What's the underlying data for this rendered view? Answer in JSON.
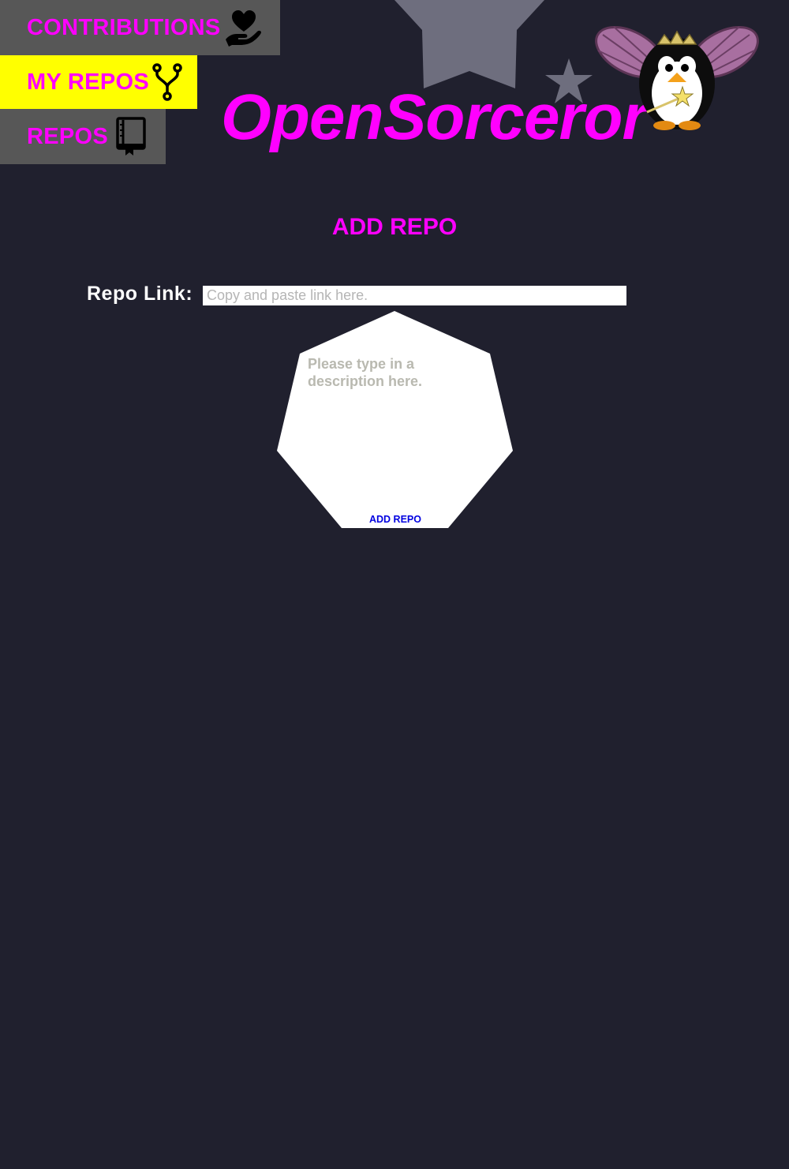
{
  "nav": {
    "contributions_label": "CONTRIBUTIONS",
    "my_repos_label": "MY REPOS",
    "repos_label": "REPOS",
    "contributions_icon": "heart-hand-icon",
    "my_repos_icon": "fork-icon",
    "repos_icon": "repo-book-icon",
    "active_item": "MY REPOS"
  },
  "header": {
    "logo_text": "OpenSorceror",
    "mascot": "fairy-penguin-mascot"
  },
  "main": {
    "heading": "ADD REPO",
    "repo_link_label": "Repo Link:",
    "repo_link_placeholder": "Copy and paste link here.",
    "description_placeholder": "Please type in a description here.",
    "submit_label": "ADD REPO"
  },
  "colors": {
    "background": "#20202e",
    "accent": "#ff00ff",
    "nav_inactive": "#575757",
    "nav_active": "#ffff00",
    "star": "#6e6e7e",
    "submit_text": "#0000e0"
  }
}
